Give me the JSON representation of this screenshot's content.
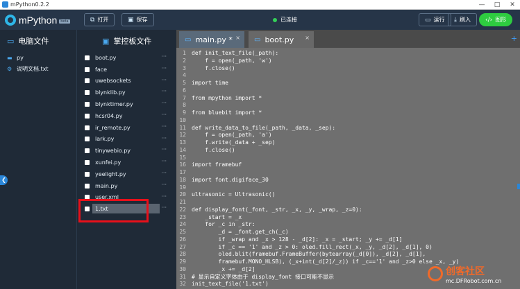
{
  "titlebar": {
    "title": "mPython0.2.2",
    "minimize": "—",
    "maximize": "□",
    "close": "✕"
  },
  "toolbar": {
    "logo_text": "mPython",
    "logo_badge": "beta",
    "open_label": "打开",
    "save_label": "保存",
    "status_text": "已连接",
    "run_label": "运行",
    "flash_label": "刷入",
    "graph_label": "图形"
  },
  "colors": {
    "status_connected": "#34d058",
    "accent": "#2a86d8",
    "graph_button": "#2ecc40",
    "highlight_box": "#e8101a"
  },
  "pc_panel": {
    "title": "电脑文件",
    "items": [
      {
        "label": "py",
        "icon": "folder-icon"
      },
      {
        "label": "说明文档.txt",
        "icon": "gear-icon"
      }
    ]
  },
  "board_panel": {
    "title": "掌控板文件",
    "more": "···",
    "items": [
      "boot.py",
      "face",
      "uwebsockets",
      "blynklib.py",
      "blynktimer.py",
      "hcsr04.py",
      "ir_remote.py",
      "lark.py",
      "tinywebio.py",
      "xunfei.py",
      "yeelight.py",
      "main.py",
      "user.xml",
      "1.txt"
    ],
    "selected": "1.txt"
  },
  "editor": {
    "tabs": [
      {
        "label": "main.py *",
        "close": "×"
      },
      {
        "label": "boot.py",
        "close": "×"
      }
    ],
    "add_tab": "+",
    "lines": [
      {
        "n": "1",
        "t": "def init_text_file(_path):"
      },
      {
        "n": "2",
        "t": "    f = open(_path, 'w')"
      },
      {
        "n": "3",
        "t": "    f.close()"
      },
      {
        "n": "4",
        "t": ""
      },
      {
        "n": "5",
        "t": "import time"
      },
      {
        "n": "6",
        "t": ""
      },
      {
        "n": "7",
        "t": "from mpython import *"
      },
      {
        "n": "8",
        "t": ""
      },
      {
        "n": "9",
        "t": "from bluebit import *"
      },
      {
        "n": "10",
        "t": ""
      },
      {
        "n": "11",
        "t": "def write_data_to_file(_path, _data, _sep):"
      },
      {
        "n": "12",
        "t": "    f = open(_path, 'a')"
      },
      {
        "n": "13",
        "t": "    f.write(_data + _sep)"
      },
      {
        "n": "14",
        "t": "    f.close()"
      },
      {
        "n": "15",
        "t": ""
      },
      {
        "n": "16",
        "t": "import framebuf"
      },
      {
        "n": "17",
        "t": ""
      },
      {
        "n": "18",
        "t": "import font.digiface_30"
      },
      {
        "n": "19",
        "t": ""
      },
      {
        "n": "20",
        "t": "ultrasonic = Ultrasonic()"
      },
      {
        "n": "21",
        "t": ""
      },
      {
        "n": "22",
        "t": "def display_font(_font, _str, _x, _y, _wrap, _z=0):"
      },
      {
        "n": "23",
        "t": "    _start = _x"
      },
      {
        "n": "24",
        "t": "    for _c in _str:"
      },
      {
        "n": "25",
        "t": "        _d = _font.get_ch(_c)"
      },
      {
        "n": "26",
        "t": "        if _wrap and _x > 128 - _d[2]: _x = _start; _y += _d[1]"
      },
      {
        "n": "27",
        "t": "        if _c == '1' and _z > 0: oled.fill_rect(_x, _y, _d[2], _d[1], 0)"
      },
      {
        "n": "28",
        "t": "        oled.blit(framebuf.FrameBuffer(bytearray(_d[0]), _d[2], _d[1],"
      },
      {
        "n": "29",
        "t": "        framebuf.MONO_HLSB), (_x+int(_d[2]/_z)) if _c=='1' and _z>0 else _x, _y)"
      },
      {
        "n": "30",
        "t": "        _x += _d[2]"
      },
      {
        "n": "31",
        "t": "# 显示自定义字体由于 display_font 接口可能不显示"
      },
      {
        "n": "32",
        "t": "init_text_file('1.txt')"
      }
    ]
  },
  "watermark": {
    "brand": "创客社区",
    "url": "mc.DFRobot.com.cn"
  },
  "collapse_icon": "chevron-left-icon"
}
